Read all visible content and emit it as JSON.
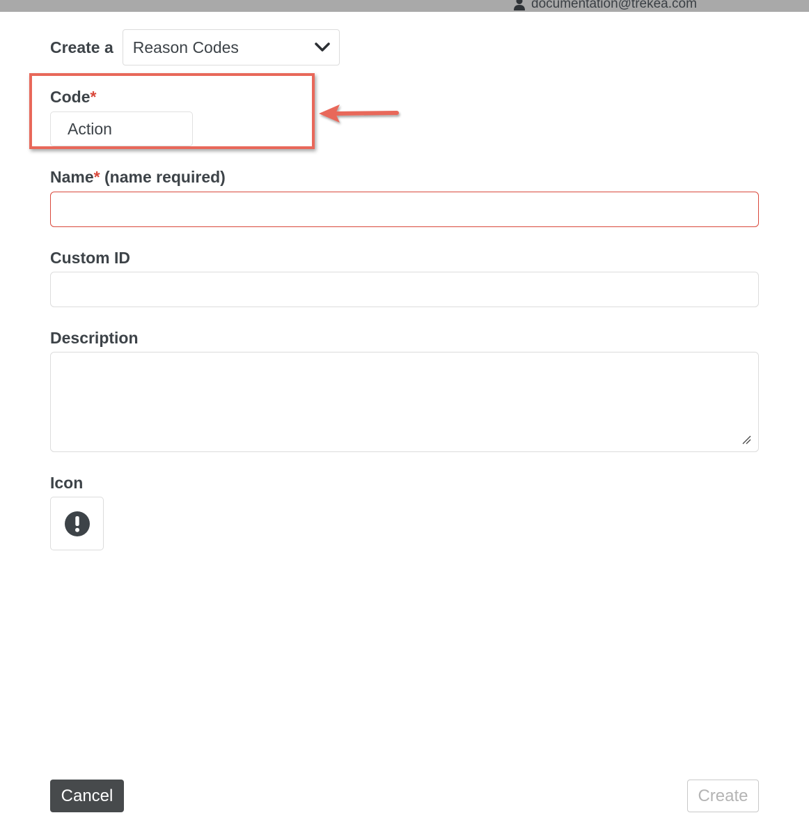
{
  "header": {
    "user_email": "documentation@trekea.com",
    "user_icon": "user-icon"
  },
  "create_row": {
    "label": "Create a",
    "selected_type": "Reason Codes",
    "dropdown_icon": "chevron-down-icon"
  },
  "form": {
    "code": {
      "label": "Code",
      "required_mark": "*",
      "value": "Action"
    },
    "name": {
      "label": "Name",
      "required_mark": "*",
      "hint": " (name required)",
      "value": "",
      "state": "invalid"
    },
    "custom_id": {
      "label": "Custom ID",
      "value": ""
    },
    "description": {
      "label": "Description",
      "value": ""
    },
    "icon": {
      "label": "Icon",
      "selected_icon": "exclamation-circle-icon"
    }
  },
  "footer": {
    "cancel_label": "Cancel",
    "create_label": "Create",
    "create_enabled": false
  },
  "colors": {
    "annotation": "#e8685a",
    "required": "#d9483b",
    "cancel_bg": "#474a4c",
    "topbar": "#a9a9a9"
  }
}
